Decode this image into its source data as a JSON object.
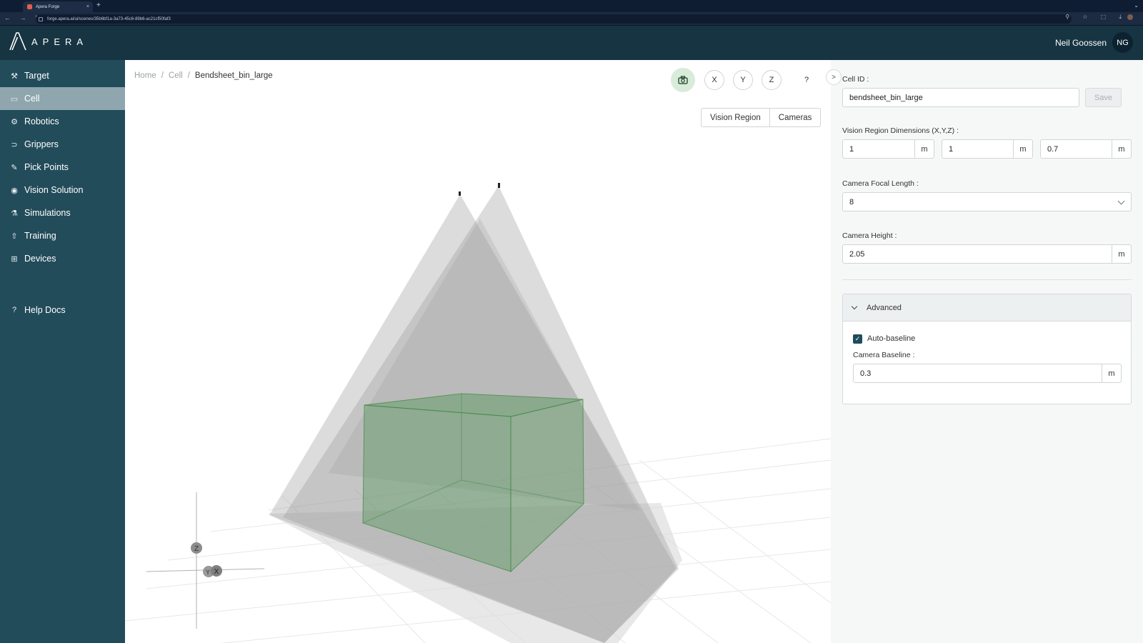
{
  "browser": {
    "tab_title": "Apera Forge",
    "tab_close": "×",
    "new_tab": "+",
    "tab_menu": "⌄",
    "nav_buttons": "← → ↻",
    "url": "forge.apera.ai/ui/scenes/35b6bf1a-3a73-45c6-89b6-ac21cf50faf3",
    "toolbar_icons": "⚲ ☆ ⬚ ⤓"
  },
  "header": {
    "logo_text": "APERA",
    "user_name": "Neil Goossen",
    "user_initials": "NG"
  },
  "sidebar": {
    "items": [
      {
        "label": "Target",
        "icon": "wrench-icon",
        "glyph": "⚒",
        "active": false
      },
      {
        "label": "Cell",
        "icon": "video-camera-icon",
        "glyph": "▭",
        "active": true
      },
      {
        "label": "Robotics",
        "icon": "robot-arm-icon",
        "glyph": "⚙",
        "active": false
      },
      {
        "label": "Grippers",
        "icon": "gripper-icon",
        "glyph": "⊃",
        "active": false
      },
      {
        "label": "Pick Points",
        "icon": "pick-icon",
        "glyph": "✎",
        "active": false
      },
      {
        "label": "Vision Solution",
        "icon": "eye-icon",
        "glyph": "◉",
        "active": false
      },
      {
        "label": "Simulations",
        "icon": "flask-icon",
        "glyph": "⚗",
        "active": false
      },
      {
        "label": "Training",
        "icon": "rocket-icon",
        "glyph": "⇧",
        "active": false
      },
      {
        "label": "Devices",
        "icon": "devices-icon",
        "glyph": "⊞",
        "active": false
      }
    ],
    "help": {
      "label": "Help Docs",
      "icon": "question-icon",
      "glyph": "?"
    }
  },
  "breadcrumb": {
    "home": "Home",
    "sep": "/",
    "cell": "Cell",
    "current": "Bendsheet_bin_large"
  },
  "view_toolbar": {
    "camera_icon": "camera-icon",
    "x": "X",
    "y": "Y",
    "z": "Z",
    "help": "?",
    "vision_region": "Vision Region",
    "cameras": "Cameras",
    "collapse": ">"
  },
  "scene": {
    "axis_x": "X",
    "axis_y": "Y",
    "axis_z": "Z",
    "box_color": "#5c9a5f",
    "frustum_color": "#9c9c9c"
  },
  "panel": {
    "cell_id_label": "Cell ID :",
    "cell_id_value": "bendsheet_bin_large",
    "save_label": "Save",
    "dims_label": "Vision Region Dimensions (X,Y,Z) :",
    "dim_x": "1",
    "dim_y": "1",
    "dim_z": "0.7",
    "unit": "m",
    "focal_label": "Camera Focal Length :",
    "focal_value": "8",
    "height_label": "Camera Height :",
    "height_value": "2.05",
    "advanced_label": "Advanced",
    "auto_baseline_label": "Auto-baseline",
    "auto_baseline_checked": true,
    "baseline_label": "Camera Baseline :",
    "baseline_value": "0.3"
  }
}
